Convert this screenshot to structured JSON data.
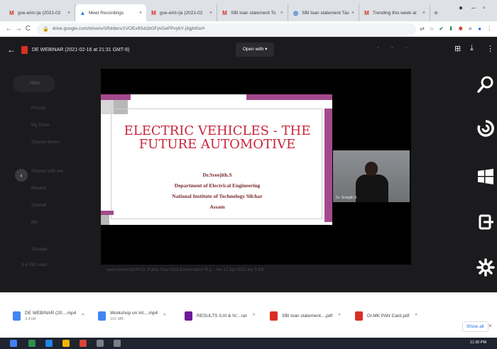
{
  "browser": {
    "tabs": [
      {
        "favicon": "gmail-icon",
        "title": "gse-eint-rja (2021-02",
        "active": false
      },
      {
        "favicon": "drive-icon",
        "title": "Meet Recordings",
        "active": true
      },
      {
        "favicon": "gmail-icon",
        "title": "gse-eint-rja (2021-02",
        "active": false
      },
      {
        "favicon": "gmail-icon",
        "title": "SBI loan statement To",
        "active": false
      },
      {
        "favicon": "sbi-icon",
        "title": "SBI loan statement Tax",
        "active": false
      },
      {
        "favicon": "gmail-icon",
        "title": "Trending this week at",
        "active": false
      }
    ],
    "new_tab": "+",
    "url": "drive.google.com/drive/u/0/folders/1VOEx9Sd1bGFjAGePPvybY-j3gjht0uH"
  },
  "viewer": {
    "file_title": "DE WEBINAR (2021-02-16 at 21:31 GMT-8)",
    "open_with": "Open with",
    "sidebar": {
      "new_label": "New",
      "items": [
        "Priority",
        "My Drive",
        "Shared drives",
        "Shared with me",
        "Recent",
        "Starred",
        "Bin",
        "Storage",
        "3.4 GB used"
      ]
    },
    "background_file": "www.university.Ph.D. Public Viva Voce Examination R.p...  me                        17 Apr 2021  me               5 KB"
  },
  "slide": {
    "title_line1": "ELECTRIC VEHICLES - THE",
    "title_line2": "FUTURE AUTOMOTIVE",
    "author": "Dr.Sreejith.S",
    "department": "Department of Electrical Engineering",
    "institute": "National Institute of Technology Silchar",
    "location": "Assam"
  },
  "participant_label": "Dr. Sreejith S",
  "downloads": [
    {
      "name": "DE WEBINAR (20....mp4",
      "size": "3.4 kB",
      "color": "#4285f4"
    },
    {
      "name": "Workshop on Int....mp4",
      "size": "101 MB",
      "color": "#4285f4"
    },
    {
      "name": "RESULTS II,III & IV....rar",
      "size": "",
      "color": "#6a1b9a"
    },
    {
      "name": "SBI loan statement....pdf",
      "size": "",
      "color": "#d93025"
    },
    {
      "name": "Dr.MK PAN Card.pdf",
      "size": "",
      "color": "#d93025"
    }
  ],
  "show_all": "Show all",
  "taskbar": {
    "time": "11:30 PM"
  }
}
